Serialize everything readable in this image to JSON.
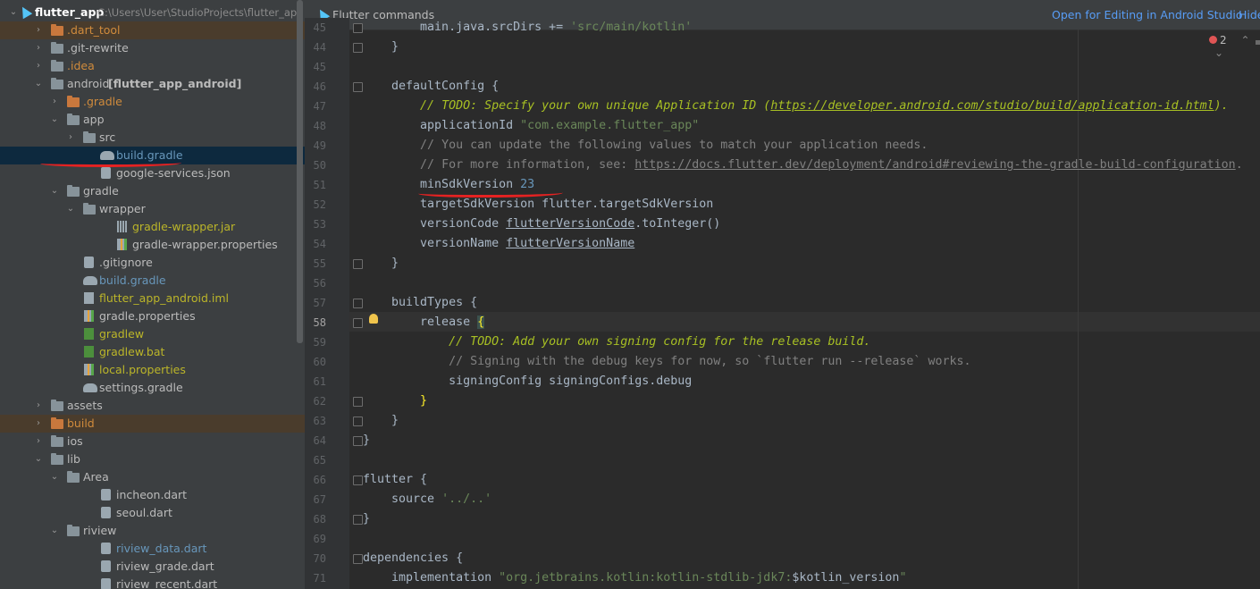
{
  "project": {
    "name": "flutter_app",
    "path": "C:\\Users\\User\\StudioProjects\\flutter_app"
  },
  "tree": [
    {
      "label": ".dart_tool",
      "color": "#d08b3c"
    },
    {
      "label": ".git-rewrite"
    },
    {
      "label": ".idea",
      "color": "#d08b3c"
    },
    {
      "label": "android",
      "extra": "[flutter_app_android]"
    },
    {
      "label": ".gradle",
      "color": "#d08b3c"
    },
    {
      "label": "app"
    },
    {
      "label": "src"
    },
    {
      "label": "build.gradle",
      "color": "#6897bb"
    },
    {
      "label": "google-services.json"
    },
    {
      "label": "gradle"
    },
    {
      "label": "wrapper"
    },
    {
      "label": "gradle-wrapper.jar",
      "color": "#bbb529"
    },
    {
      "label": "gradle-wrapper.properties"
    },
    {
      "label": ".gitignore"
    },
    {
      "label": "build.gradle",
      "color": "#6897bb"
    },
    {
      "label": "flutter_app_android.iml",
      "color": "#bbb529"
    },
    {
      "label": "gradle.properties"
    },
    {
      "label": "gradlew",
      "color": "#bbb529"
    },
    {
      "label": "gradlew.bat",
      "color": "#bbb529"
    },
    {
      "label": "local.properties",
      "color": "#bbb529"
    },
    {
      "label": "settings.gradle"
    },
    {
      "label": "assets"
    },
    {
      "label": "build",
      "color": "#d08b3c"
    },
    {
      "label": "ios"
    },
    {
      "label": "lib"
    },
    {
      "label": "Area"
    },
    {
      "label": "incheon.dart"
    },
    {
      "label": "seoul.dart"
    },
    {
      "label": "riview"
    },
    {
      "label": "riview_data.dart",
      "color": "#6897bb"
    },
    {
      "label": "riview_grade.dart"
    },
    {
      "label": "riview_recent.dart"
    }
  ],
  "editor": {
    "header_title": "Flutter commands",
    "open_link": "Open for Editing in Android Studio",
    "hide_link": "Hide",
    "error_count": "2",
    "line_numbers": [
      "45",
      "44",
      "45",
      "46",
      "47",
      "48",
      "49",
      "50",
      "51",
      "52",
      "53",
      "54",
      "55",
      "56",
      "57",
      "58",
      "59",
      "60",
      "61",
      "62",
      "63",
      "64",
      "65",
      "66",
      "67",
      "68",
      "69",
      "70",
      "71"
    ],
    "current_line": "58"
  }
}
